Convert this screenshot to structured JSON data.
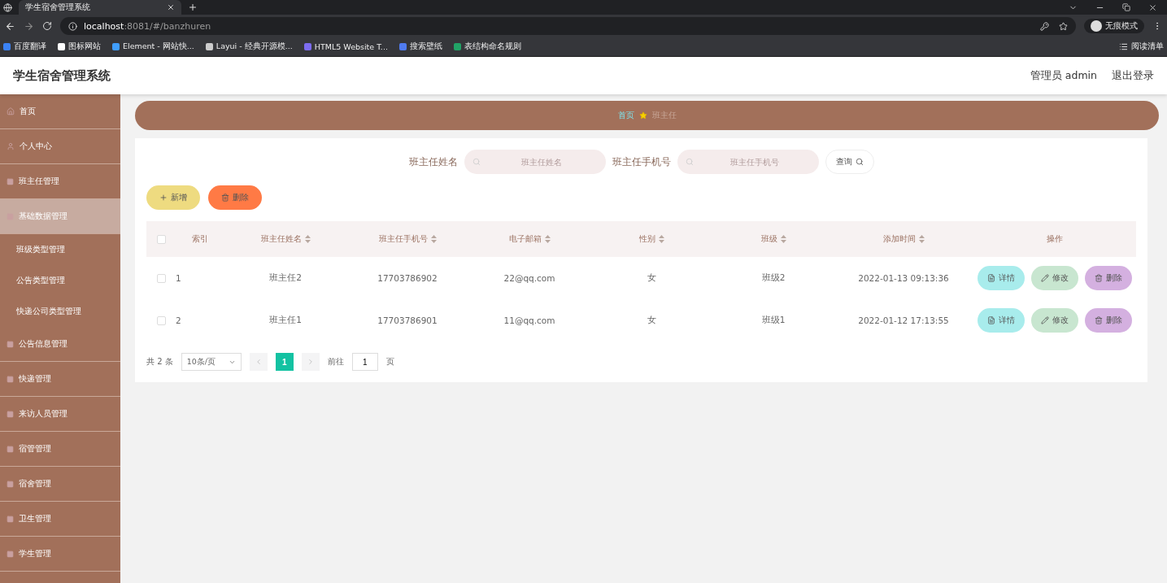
{
  "browser": {
    "tab_title": "学生宿舍管理系统",
    "url_host": "localhost",
    "url_path": ":8081/#/banzhuren",
    "profile": "无痕模式",
    "reading_list": "阅读清单",
    "bookmarks": [
      {
        "label": "百度翻译",
        "color": "#3b82f6"
      },
      {
        "label": "图标网站",
        "color": "#ffffff"
      },
      {
        "label": "Element - 网站快...",
        "color": "#409eff"
      },
      {
        "label": "Layui - 经典开源模...",
        "color": "#cccccc"
      },
      {
        "label": "HTML5 Website T...",
        "color": "#7c6cf0"
      },
      {
        "label": "搜索壁纸",
        "color": "#4f7bf0"
      },
      {
        "label": "表结构命名规则",
        "color": "#21a366"
      }
    ]
  },
  "header": {
    "title": "学生宿舍管理系统",
    "user": "管理员 admin",
    "logout": "退出登录"
  },
  "sidebar": {
    "items": [
      {
        "label": "首页",
        "selected": false
      },
      {
        "label": "个人中心",
        "selected": false
      },
      {
        "label": "班主任管理",
        "selected": false
      },
      {
        "label": "基础数据管理",
        "selected": true,
        "children": [
          {
            "label": "班级类型管理"
          },
          {
            "label": "公告类型管理"
          },
          {
            "label": "快递公司类型管理"
          }
        ]
      },
      {
        "label": "公告信息管理",
        "selected": false
      },
      {
        "label": "快递管理",
        "selected": false
      },
      {
        "label": "来访人员管理",
        "selected": false
      },
      {
        "label": "宿管管理",
        "selected": false
      },
      {
        "label": "宿舍管理",
        "selected": false
      },
      {
        "label": "卫生管理",
        "selected": false
      },
      {
        "label": "学生管理",
        "selected": false
      }
    ]
  },
  "breadcrumb": [
    "首页",
    "班主任"
  ],
  "search": {
    "fields": [
      {
        "label": "班主任姓名",
        "placeholder": "班主任姓名"
      },
      {
        "label": "班主任手机号",
        "placeholder": "班主任手机号"
      }
    ],
    "button": "查询"
  },
  "actions": {
    "add": "新增",
    "delete": "删除"
  },
  "table": {
    "all_checked": false,
    "columns": [
      {
        "label": "索引",
        "sortable": false
      },
      {
        "label": "班主任姓名",
        "sortable": true
      },
      {
        "label": "班主任手机号",
        "sortable": true
      },
      {
        "label": "电子邮箱",
        "sortable": true
      },
      {
        "label": "性别",
        "sortable": true
      },
      {
        "label": "班级",
        "sortable": true
      },
      {
        "label": "添加时间",
        "sortable": true
      },
      {
        "label": "操作",
        "sortable": false
      }
    ],
    "rows": [
      {
        "checked": false,
        "cells": [
          "1",
          "班主任2",
          "17703786902",
          "22@qq.com",
          "女",
          "班级2",
          "2022-01-13 09:13:36"
        ],
        "buttons": [
          {
            "kind": "detail",
            "label": "详情"
          },
          {
            "kind": "edit",
            "label": "修改"
          },
          {
            "kind": "delete",
            "label": "删除"
          }
        ]
      },
      {
        "checked": false,
        "cells": [
          "2",
          "班主任1",
          "17703786901",
          "11@qq.com",
          "女",
          "班级1",
          "2022-01-12 17:13:55"
        ],
        "buttons": [
          {
            "kind": "detail",
            "label": "详情"
          },
          {
            "kind": "edit",
            "label": "修改"
          },
          {
            "kind": "delete",
            "label": "删除"
          }
        ]
      }
    ]
  },
  "pagination": {
    "total": "共 2 条",
    "page_size": "10条/页",
    "pages": [
      {
        "label": "1",
        "selected": true
      }
    ],
    "goto": "前往",
    "goto_value": "1",
    "page_unit": "页"
  }
}
